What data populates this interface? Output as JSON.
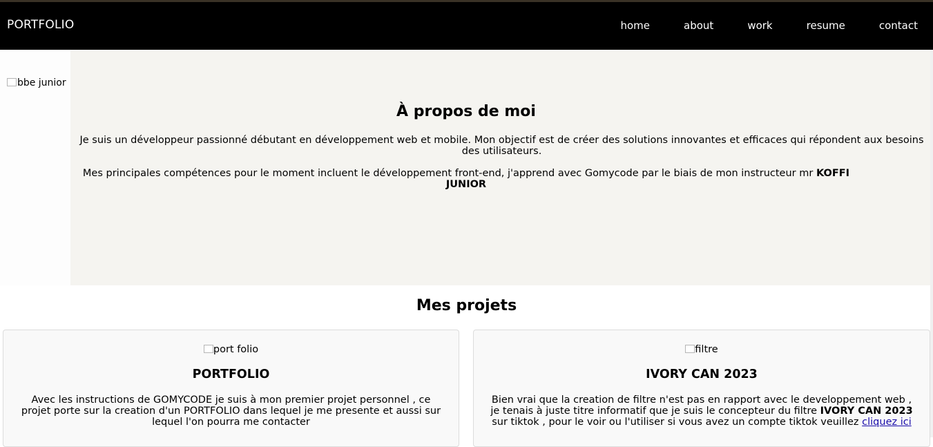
{
  "header": {
    "brand": "PORTFOLIO",
    "nav": [
      "home",
      "about",
      "work",
      "resume",
      "contact"
    ]
  },
  "about": {
    "photo_alt": "abbe junior",
    "title": "À propos de moi",
    "paragraph1": "Je suis un développeur passionné débutant en développement web et mobile. Mon objectif est de créer des solutions innovantes et efficaces qui répondent aux besoins des utilisateurs.",
    "paragraph2_prefix": "Mes principales compétences pour le moment incluent le développement front-end, j'apprend avec Gomycode par le biais de mon instructeur mr ",
    "paragraph2_bold": "KOFFI JUNIOR"
  },
  "projects": {
    "title": "Mes projets",
    "cards": [
      {
        "image_alt": "port folio",
        "title": "PORTFOLIO",
        "description": "Avec les instructions de GOMYCODE je suis à mon premier projet personnel , ce projet porte sur la creation d'un PORTFOLIO dans lequel je me presente et aussi sur lequel l'on pourra me contacter"
      },
      {
        "image_alt": "filtre",
        "title": "IVORY CAN 2023",
        "description_prefix": "Bien vrai que la creation de filtre n'est pas en rapport avec le developpement web , je tenais à juste titre informatif que je suis le concepteur du filtre ",
        "description_bold": "IVORY CAN 2023",
        "description_suffix": " sur tiktok , pour le voir ou l'utiliser si vous avez un compte tiktok veuillez ",
        "link_label": "cliquez ici"
      }
    ]
  },
  "colors": {
    "header_bg": "#000000",
    "about_bg": "#f5f4f0",
    "card_bg": "#f9f9f9",
    "link": "#1a0dab"
  }
}
